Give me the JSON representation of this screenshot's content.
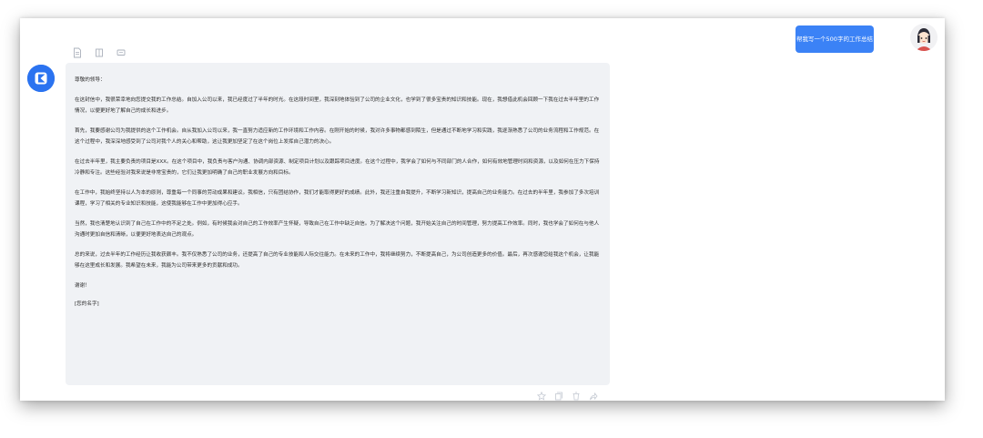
{
  "user_message": {
    "text": "帮我写一个500字的工作总结"
  },
  "toolbar": {
    "icons": [
      "document-icon",
      "grid-icon",
      "comment-icon"
    ]
  },
  "answer": {
    "greeting": "尊敬的领导：",
    "paragraphs": [
      "在这封信中，我很荣幸地向您提交我的工作总结。自加入公司以来，我已经度过了半年的时光。在这段时间里，我深刻地体验到了公司的企业文化，也学到了很多宝贵的知识和技能。现在，我想借此机会回顾一下我在过去半年里的工作情况，以便更好地了解自己的成长和进步。",
      "首先，我要感谢公司为我提供的这个工作机会。自从我加入公司以来，我一直努力适应新的工作环境和工作内容。在刚开始的时候，我对许多事物都感到陌生，但是通过不断地学习和实践，我逐渐熟悉了公司的业务流程和工作规范。在这个过程中，我深深地感受到了公司对我个人的关心和帮助，这让我更加坚定了在这个岗位上发挥自己潜力的决心。",
      "在过去半年里，我主要负责的项目是XXX。在这个项目中，我负责与客户沟通、协调内部资源、制定项目计划以及跟踪项目进度。在这个过程中，我学会了如何与不同部门的人合作，如何有效地管理时间和资源，以及如何在压力下保持冷静和专注。这些经验对我来说是非常宝贵的，它们让我更加明确了自己的职业发展方向和目标。",
      "在工作中，我始终坚持以人为本的原则，尊重每一个同事的劳动成果和建议。我相信，只有团结协作，我们才能取得更好的成绩。此外，我还注重自我提升，不断学习新知识，提高自己的业务能力。在过去的半年里，我参加了多次培训课程，学习了相关的专业知识和技能，这使我能够在工作中更加得心应手。",
      "当然，我也清楚地认识到了自己在工作中的不足之处。例如，有时候我会对自己的工作效率产生怀疑，导致自己在工作中缺乏自信。为了解决这个问题，我开始关注自己的时间管理，努力提高工作效率。同时，我也学会了如何在与他人沟通时更加自信和清晰，以便更好地表达自己的观点。",
      "总的来说，过去半年的工作经历让我收获颇丰。我不仅熟悉了公司的业务，还提高了自己的专业技能和人际交往能力。在未来的工作中，我将继续努力，不断提高自己，为公司创造更多的价值。最后，再次感谢您给我这个机会，让我能够在这里成长和发展。我希望在未来，我能为公司带来更多的贡献和成功。"
    ],
    "closing": "谢谢！",
    "signature": "[您的名字]"
  },
  "actions": {
    "icons": [
      "star-icon",
      "copy-icon",
      "delete-icon",
      "share-icon"
    ]
  },
  "colors": {
    "accent": "#3b82f6",
    "bot_avatar": "#2b73f0",
    "card_bg": "#f0f2f5"
  }
}
